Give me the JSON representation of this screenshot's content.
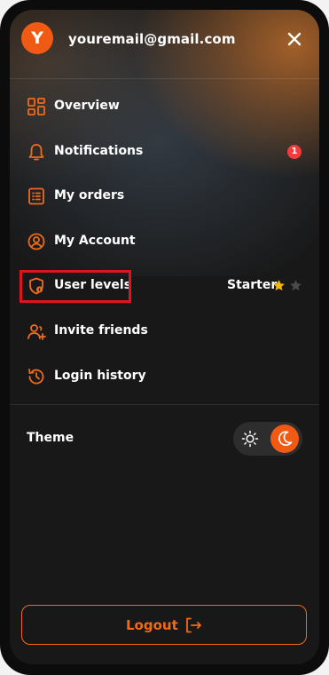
{
  "user": {
    "avatar_letter": "Y",
    "email": "youremail@gmail.com"
  },
  "menu": {
    "items": [
      {
        "label": "Overview",
        "icon": "grid-icon"
      },
      {
        "label": "Notifications",
        "icon": "bell-icon",
        "badge": "1"
      },
      {
        "label": "My orders",
        "icon": "receipt-icon"
      },
      {
        "label": "My Account",
        "icon": "user-circle-icon"
      },
      {
        "label": "User levels",
        "icon": "shield-icon",
        "level": "Starter",
        "stars_filled": 1,
        "stars_total": 2
      },
      {
        "label": "Invite friends",
        "icon": "user-plus-icon"
      },
      {
        "label": "Login history",
        "icon": "history-icon"
      }
    ]
  },
  "theme": {
    "label": "Theme",
    "mode": "dark"
  },
  "logout": {
    "label": "Logout"
  },
  "colors": {
    "accent": "#f15a12",
    "badge": "#f23c3c",
    "star": "#f5b700",
    "highlight": "#e0141e"
  }
}
